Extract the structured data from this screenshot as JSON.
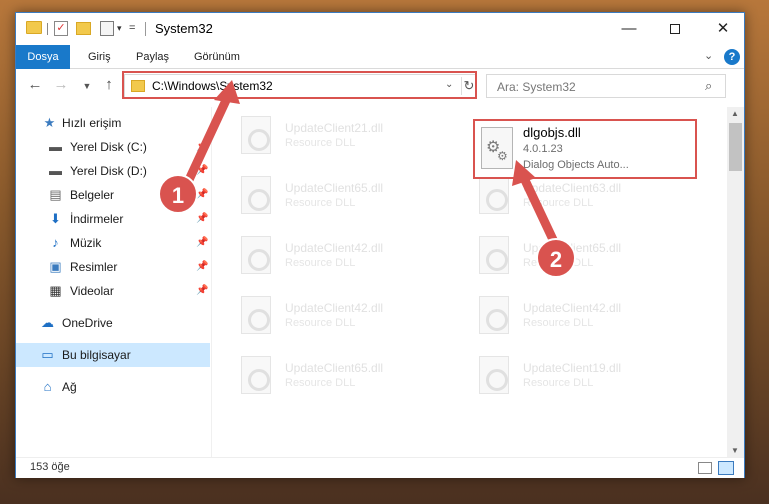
{
  "window": {
    "title": "System32",
    "minimize_glyph": "—",
    "close_glyph": "✕"
  },
  "ribbon": {
    "tabs": [
      "Dosya",
      "Giriş",
      "Paylaş",
      "Görünüm"
    ]
  },
  "navigation": {
    "address": "C:\\Windows\\System32",
    "search_placeholder": "Ara: System32"
  },
  "sidebar": {
    "items": [
      {
        "label": "Hızlı erişim",
        "icon": "star-icon",
        "pinned": false
      },
      {
        "label": "Yerel Disk (C:)",
        "icon": "drive-icon",
        "pinned": true
      },
      {
        "label": "Yerel Disk (D:)",
        "icon": "drive-icon",
        "pinned": true
      },
      {
        "label": "Belgeler",
        "icon": "documents-icon",
        "pinned": true
      },
      {
        "label": "İndirmeler",
        "icon": "download-icon",
        "pinned": true
      },
      {
        "label": "Müzik",
        "icon": "music-icon",
        "pinned": true
      },
      {
        "label": "Resimler",
        "icon": "pictures-icon",
        "pinned": true
      },
      {
        "label": "Videolar",
        "icon": "videos-icon",
        "pinned": true
      },
      {
        "label": "OneDrive",
        "icon": "onedrive-icon",
        "pinned": false
      },
      {
        "label": "Bu bilgisayar",
        "icon": "computer-icon",
        "pinned": false,
        "selected": true
      },
      {
        "label": "Ağ",
        "icon": "network-icon",
        "pinned": false
      }
    ]
  },
  "files": {
    "featured": {
      "name": "dlgobjs.dll",
      "version": "4.0.1.23",
      "description": "Dialog Objects Auto..."
    },
    "left_column": [
      {
        "name": "UpdateClient21.dll",
        "desc": "Resource DLL"
      },
      {
        "name": "UpdateClient65.dll",
        "desc": "Resource DLL"
      },
      {
        "name": "UpdateClient42.dll",
        "desc": "Resource DLL"
      },
      {
        "name": "UpdateClient42.dll",
        "desc": "Resource DLL"
      },
      {
        "name": "UpdateClient65.dll",
        "desc": "Resource DLL"
      }
    ],
    "right_column": [
      {
        "name": "UpdateClient63.dll",
        "desc": "Resource DLL"
      },
      {
        "name": "UpdateClient65.dll",
        "desc": "Resource DLL"
      },
      {
        "name": "UpdateClient42.dll",
        "desc": "Resource DLL"
      },
      {
        "name": "UpdateClient19.dll",
        "desc": "Resource DLL"
      }
    ]
  },
  "status": {
    "item_count": "153 öğe"
  },
  "annotations": {
    "badge1": "1",
    "badge2": "2",
    "color": "#d9534f"
  }
}
